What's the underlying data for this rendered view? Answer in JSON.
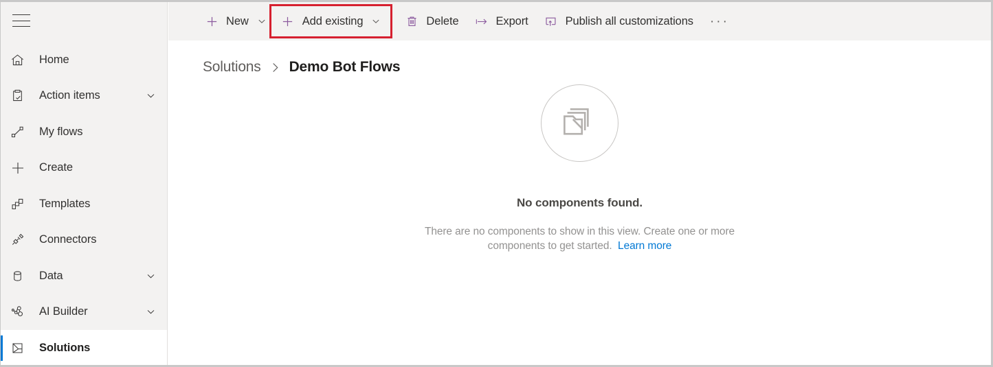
{
  "sidebar": {
    "menu_button": "menu-hamburger",
    "items": [
      {
        "label": "Home",
        "icon": "home-icon",
        "chevron": false,
        "selected": false
      },
      {
        "label": "Action items",
        "icon": "clipboard-check-icon",
        "chevron": true,
        "selected": false
      },
      {
        "label": "My flows",
        "icon": "flow-icon",
        "chevron": false,
        "selected": false
      },
      {
        "label": "Create",
        "icon": "plus-icon",
        "chevron": false,
        "selected": false
      },
      {
        "label": "Templates",
        "icon": "templates-icon",
        "chevron": false,
        "selected": false
      },
      {
        "label": "Connectors",
        "icon": "connectors-icon",
        "chevron": false,
        "selected": false
      },
      {
        "label": "Data",
        "icon": "database-icon",
        "chevron": true,
        "selected": false
      },
      {
        "label": "AI Builder",
        "icon": "ai-builder-icon",
        "chevron": true,
        "selected": false
      },
      {
        "label": "Solutions",
        "icon": "solutions-icon",
        "chevron": false,
        "selected": true
      }
    ]
  },
  "toolbar": {
    "new_label": "New",
    "add_existing_label": "Add existing",
    "delete_label": "Delete",
    "export_label": "Export",
    "publish_label": "Publish all customizations",
    "overflow_label": "···",
    "highlight_color": "#d6202f",
    "icon_color": "#8b5a9e"
  },
  "breadcrumb": {
    "root": "Solutions",
    "separator": "›",
    "current": "Demo Bot Flows"
  },
  "empty_state": {
    "icon": "stacked-folders-icon",
    "title": "No components found.",
    "description": "There are no components to show in this view. Create one or more components to get started.",
    "link_label": "Learn more",
    "link_color": "#0078d4"
  }
}
